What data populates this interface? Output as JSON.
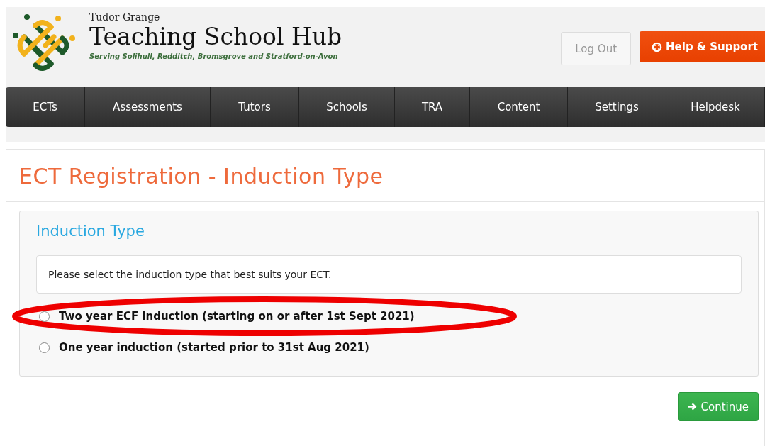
{
  "header": {
    "org": "Tudor Grange",
    "title": "Teaching School Hub",
    "tagline": "Serving Solihull, Redditch, Bromsgrove and Stratford-on-Avon",
    "buttons": [
      {
        "kind": "plain",
        "label": "Log Out"
      },
      {
        "kind": "help",
        "label": "Help & Support"
      }
    ]
  },
  "nav": [
    {
      "label": "ECTs"
    },
    {
      "label": "Assessments"
    },
    {
      "label": "Tutors"
    },
    {
      "label": "Schools"
    },
    {
      "label": "TRA"
    },
    {
      "label": "Content"
    },
    {
      "label": "Settings"
    },
    {
      "label": "Helpdesk"
    }
  ],
  "page": {
    "title": "ECT Registration - Induction Type",
    "section": "Induction Type",
    "message": "Please select the induction type that best suits your ECT.",
    "options": [
      {
        "label": "Two year ECF induction (starting on or after 1st Sept 2021)",
        "selected": false,
        "highlighted": true
      },
      {
        "label": "One year induction (started prior to 31st Aug 2021)",
        "selected": false,
        "highlighted": false
      }
    ],
    "continue": "Continue"
  }
}
